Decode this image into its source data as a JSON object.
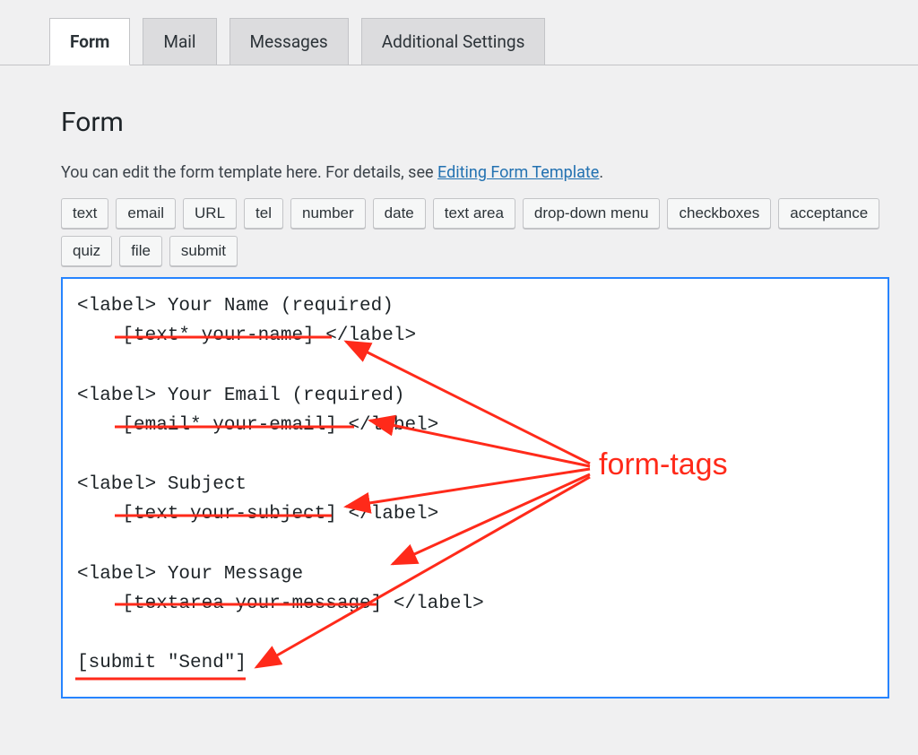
{
  "tabs": [
    {
      "label": "Form",
      "active": true
    },
    {
      "label": "Mail",
      "active": false
    },
    {
      "label": "Messages",
      "active": false
    },
    {
      "label": "Additional Settings",
      "active": false
    }
  ],
  "section": {
    "title": "Form",
    "intro_prefix": "You can edit the form template here. For details, see ",
    "intro_link": "Editing Form Template",
    "intro_suffix": "."
  },
  "tag_buttons": [
    "text",
    "email",
    "URL",
    "tel",
    "number",
    "date",
    "text area",
    "drop-down menu",
    "checkboxes",
    "acceptance",
    "quiz",
    "file",
    "submit"
  ],
  "editor_content": "<label> Your Name (required)\n    [text* your-name] </label>\n\n<label> Your Email (required)\n    [email* your-email] </label>\n\n<label> Subject\n    [text your-subject] </label>\n\n<label> Your Message\n    [textarea your-message] </label>\n\n[submit \"Send\"]",
  "annotation": {
    "label": "form-tags",
    "color": "#ff2a1a"
  }
}
